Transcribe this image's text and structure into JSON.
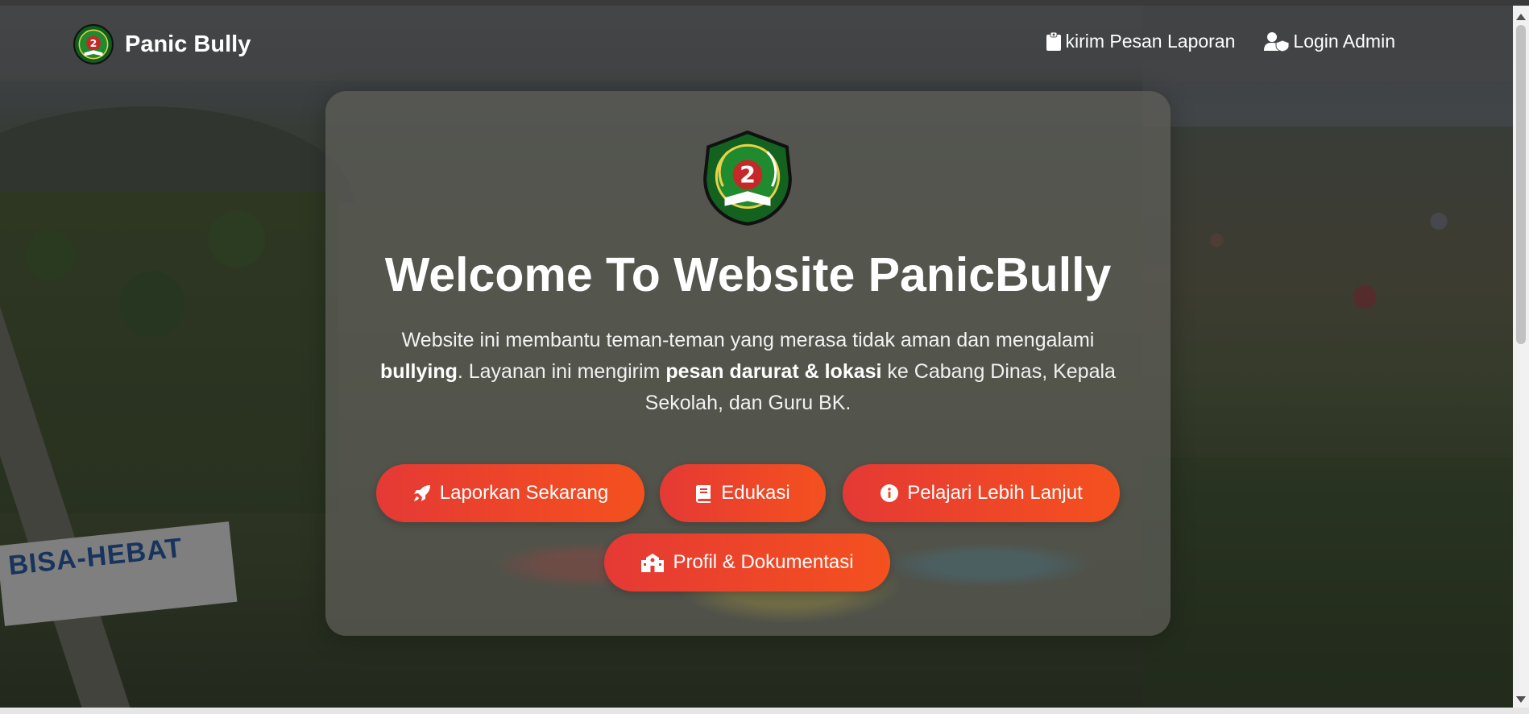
{
  "navbar": {
    "brand": "Panic Bully",
    "brand_logo_icon": "school-logo-icon",
    "links": [
      {
        "label": "kirim Pesan Laporan",
        "icon": "clipboard-icon"
      },
      {
        "label": "Login Admin",
        "icon": "user-shield-icon"
      }
    ]
  },
  "hero": {
    "logo_icon": "school-emblem-icon",
    "title": "Welcome To Website PanicBully",
    "description": {
      "part1": "Website ini membantu teman-teman yang merasa tidak aman dan mengalami ",
      "bold1": "bullying",
      "part2": ". Layanan ini mengirim ",
      "bold2": "pesan darurat & lokasi",
      "part3": " ke Cabang Dinas, Kepala Sekolah, dan Guru BK."
    },
    "buttons": [
      {
        "label": "Laporkan Sekarang",
        "icon": "rocket-icon"
      },
      {
        "label": "Edukasi",
        "icon": "book-icon"
      },
      {
        "label": "Pelajari Lebih Lanjut",
        "icon": "info-icon"
      },
      {
        "label": "Profil & Dokumentasi",
        "icon": "school-building-icon"
      }
    ]
  },
  "background": {
    "sign_text": "BISA-HEBAT"
  },
  "colors": {
    "button_start": "#e53935",
    "button_end": "#f4511e",
    "emblem_green": "#1a7a2a"
  }
}
